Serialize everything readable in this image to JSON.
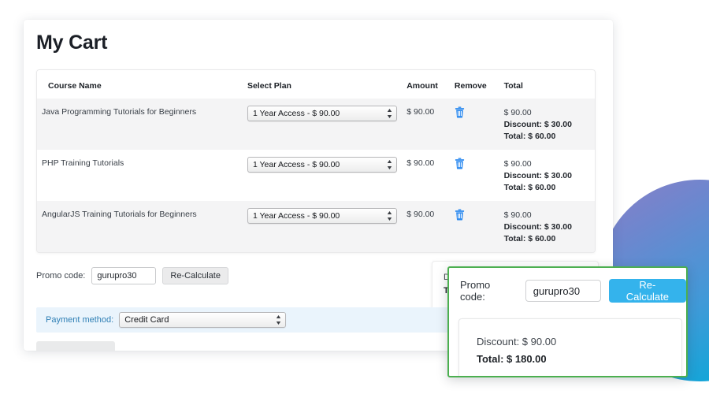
{
  "page": {
    "title": "My Cart"
  },
  "table": {
    "headers": {
      "course_name": "Course Name",
      "select_plan": "Select Plan",
      "amount": "Amount",
      "remove": "Remove",
      "total": "Total"
    },
    "rows": [
      {
        "course_name": "Java Programming Tutorials for Beginners",
        "plan": "1 Year Access - $ 90.00",
        "amount": "$ 90.00",
        "remove_icon": "trash-icon",
        "total_amount": "$ 90.00",
        "total_discount": "Discount: $ 30.00",
        "total_net": "Total: $ 60.00"
      },
      {
        "course_name": "PHP Training Tutorials",
        "plan": "1 Year Access - $ 90.00",
        "amount": "$ 90.00",
        "remove_icon": "trash-icon",
        "total_amount": "$ 90.00",
        "total_discount": "Discount: $ 30.00",
        "total_net": "Total: $ 60.00"
      },
      {
        "course_name": "AngularJS Training Tutorials for Beginners",
        "plan": "1 Year Access - $ 90.00",
        "amount": "$ 90.00",
        "remove_icon": "trash-icon",
        "total_amount": "$ 90.00",
        "total_discount": "Discount: $ 30.00",
        "total_net": "Total: $ 60.00"
      }
    ]
  },
  "promo": {
    "label": "Promo code:",
    "value": "gurupro30",
    "placeholder": "Promo code",
    "button": "Re-Calculate"
  },
  "summary": {
    "discount": "Discount: $ 90.00",
    "total": "Total: $ 180.00"
  },
  "payment": {
    "label": "Payment method:",
    "value": "Credit Card"
  },
  "callout": {
    "promo_label": "Promo code:",
    "promo_value": "gurupro30",
    "promo_placeholder": "Promo code",
    "button": "Re-Calculate",
    "discount": "Discount: $ 90.00",
    "total": "Total: $ 180.00",
    "border_color": "#4caf50",
    "button_color": "#34b3ec"
  },
  "decor": {
    "circle_top_color": "#8b7fc6",
    "circle_bottom_color": "#0aa4d6"
  }
}
